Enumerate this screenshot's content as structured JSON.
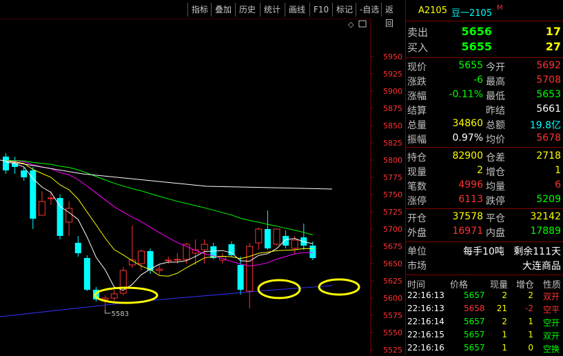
{
  "toolbar": {
    "items": [
      "指标",
      "叠加",
      "历史",
      "统计",
      "画线",
      "F10",
      "标记",
      "-自选",
      "返回"
    ]
  },
  "chart_panel": {
    "price_labels": [
      "5950",
      "5925",
      "5900",
      "5875",
      "5850",
      "5825",
      "5800",
      "5775",
      "5750",
      "5725",
      "5700",
      "5675",
      "5650",
      "5625",
      "5600",
      "5575",
      "5550",
      "5525"
    ],
    "low_marker": "5583",
    "colors": {
      "up": "#ff3232",
      "down": "#00ffff",
      "ma5": "#ffffff",
      "ma10": "#ffff00",
      "ma20": "#ff00ff",
      "ma40": "#00ff00",
      "ma60": "#ffffff",
      "ma120": "#3333ff",
      "circle": "#ffff00",
      "grid": "#800000"
    }
  },
  "chart_data": {
    "type": "candlestick",
    "y_range": [
      5525,
      5960
    ],
    "candles": [
      {
        "o": 5805,
        "h": 5810,
        "l": 5780,
        "c": 5785
      },
      {
        "o": 5795,
        "h": 5805,
        "l": 5780,
        "c": 5790
      },
      {
        "o": 5785,
        "h": 5790,
        "l": 5770,
        "c": 5775
      },
      {
        "o": 5785,
        "h": 5790,
        "l": 5700,
        "c": 5715
      },
      {
        "o": 5720,
        "h": 5755,
        "l": 5720,
        "c": 5740
      },
      {
        "o": 5745,
        "h": 5755,
        "l": 5735,
        "c": 5745
      },
      {
        "o": 5745,
        "h": 5750,
        "l": 5685,
        "c": 5690
      },
      {
        "o": 5710,
        "h": 5740,
        "l": 5690,
        "c": 5730
      },
      {
        "o": 5680,
        "h": 5690,
        "l": 5660,
        "c": 5665
      },
      {
        "o": 5658,
        "h": 5662,
        "l": 5610,
        "c": 5612
      },
      {
        "o": 5612,
        "h": 5616,
        "l": 5595,
        "c": 5598
      },
      {
        "o": 5598,
        "h": 5604,
        "l": 5583,
        "c": 5600
      },
      {
        "o": 5600,
        "h": 5612,
        "l": 5596,
        "c": 5606
      },
      {
        "o": 5607,
        "h": 5645,
        "l": 5604,
        "c": 5640
      },
      {
        "o": 5648,
        "h": 5705,
        "l": 5644,
        "c": 5655
      },
      {
        "o": 5650,
        "h": 5670,
        "l": 5640,
        "c": 5668
      },
      {
        "o": 5668,
        "h": 5672,
        "l": 5635,
        "c": 5640
      },
      {
        "o": 5640,
        "h": 5648,
        "l": 5634,
        "c": 5642
      },
      {
        "o": 5655,
        "h": 5660,
        "l": 5650,
        "c": 5655
      },
      {
        "o": 5655,
        "h": 5665,
        "l": 5650,
        "c": 5656
      },
      {
        "o": 5656,
        "h": 5680,
        "l": 5650,
        "c": 5678
      },
      {
        "o": 5665,
        "h": 5685,
        "l": 5648,
        "c": 5670
      },
      {
        "o": 5670,
        "h": 5685,
        "l": 5650,
        "c": 5678
      },
      {
        "o": 5675,
        "h": 5680,
        "l": 5656,
        "c": 5658
      },
      {
        "o": 5655,
        "h": 5665,
        "l": 5650,
        "c": 5660
      },
      {
        "o": 5678,
        "h": 5682,
        "l": 5660,
        "c": 5662
      },
      {
        "o": 5648,
        "h": 5660,
        "l": 5605,
        "c": 5612
      },
      {
        "o": 5610,
        "h": 5680,
        "l": 5585,
        "c": 5675
      },
      {
        "o": 5680,
        "h": 5702,
        "l": 5670,
        "c": 5700
      },
      {
        "o": 5700,
        "h": 5727,
        "l": 5670,
        "c": 5672
      },
      {
        "o": 5678,
        "h": 5700,
        "l": 5676,
        "c": 5700
      },
      {
        "o": 5690,
        "h": 5698,
        "l": 5672,
        "c": 5676
      },
      {
        "o": 5672,
        "h": 5690,
        "l": 5665,
        "c": 5684
      },
      {
        "o": 5688,
        "h": 5708,
        "l": 5670,
        "c": 5676
      },
      {
        "o": 5676,
        "h": 5682,
        "l": 5655,
        "c": 5658
      }
    ]
  },
  "quote": {
    "header": {
      "code": "A2105",
      "name": "豆一2105",
      "flag": "M"
    },
    "sell": {
      "label": "卖出",
      "price": "5656",
      "vol": "17"
    },
    "buy": {
      "label": "买入",
      "price": "5655",
      "vol": "27"
    },
    "rows": [
      {
        "l1": "现价",
        "v1": "5655",
        "l2": "今开",
        "v2": "5692",
        "c1": "#00ff00",
        "c2": "#ff3232"
      },
      {
        "l1": "涨跌",
        "v1": "-6",
        "l2": "最高",
        "v2": "5708",
        "c1": "#00ff00",
        "c2": "#ff3232"
      },
      {
        "l1": "涨幅",
        "v1": "-0.11%",
        "l2": "最低",
        "v2": "5653",
        "c1": "#00ff00",
        "c2": "#00ff00"
      },
      {
        "l1": "结算",
        "v1": "",
        "l2": "昨结",
        "v2": "5661",
        "c1": "#ffffff",
        "c2": "#ffffff"
      },
      {
        "l1": "总量",
        "v1": "34860",
        "l2": "总额",
        "v2": "19.8亿",
        "c1": "#ffff00",
        "c2": "#00ffff"
      },
      {
        "l1": "振幅",
        "v1": "0.97%",
        "l2": "均价",
        "v2": "5678",
        "c1": "#ffffff",
        "c2": "#ff3232"
      }
    ],
    "rows2": [
      {
        "l1": "持仓",
        "v1": "82900",
        "l2": "仓差",
        "v2": "2718",
        "c1": "#ffff00",
        "c2": "#ffff00"
      },
      {
        "l1": "现量",
        "v1": "2",
        "l2": "增仓",
        "v2": "1",
        "c1": "#ffff00",
        "c2": "#ffff00"
      },
      {
        "l1": "笔数",
        "v1": "4996",
        "l2": "均量",
        "v2": "6",
        "c1": "#ff3232",
        "c2": "#ff3232"
      },
      {
        "l1": "涨停",
        "v1": "6113",
        "l2": "跌停",
        "v2": "5209",
        "c1": "#ff3232",
        "c2": "#00ff00"
      }
    ],
    "rows3": [
      {
        "l1": "开仓",
        "v1": "37578",
        "l2": "平仓",
        "v2": "32142",
        "c1": "#ffff00",
        "c2": "#ffff00"
      },
      {
        "l1": "外盘",
        "v1": "16971",
        "l2": "内盘",
        "v2": "17889",
        "c1": "#ff3232",
        "c2": "#00ff00"
      }
    ],
    "unit": {
      "label": "单位",
      "value": "每手10吨   剩余111天"
    },
    "market": {
      "label": "市场",
      "value": "大连商品"
    }
  },
  "ticks": {
    "headers": [
      "时间",
      "价格",
      "现量",
      "增仓",
      "性质"
    ],
    "rows": [
      {
        "time": "22:16:13",
        "price": "5657",
        "vol": "2",
        "oi": "2",
        "type": "双开",
        "pc": "#00ff00",
        "tc": "#ff3232"
      },
      {
        "time": "22:16:13",
        "price": "5658",
        "vol": "21",
        "oi": "-2",
        "type": "空平",
        "pc": "#ff3232",
        "tc": "#ff3232"
      },
      {
        "time": "22:16:14",
        "price": "5657",
        "vol": "2",
        "oi": "1",
        "type": "空开",
        "pc": "#00ff00",
        "tc": "#00ff00"
      },
      {
        "time": "22:16:15",
        "price": "5657",
        "vol": "1",
        "oi": "1",
        "type": "双开",
        "pc": "#00ff00",
        "tc": "#00ff00"
      },
      {
        "time": "22:16:16",
        "price": "5657",
        "vol": "1",
        "oi": "0",
        "type": "空换",
        "pc": "#00ff00",
        "tc": "#00ff00"
      }
    ]
  }
}
